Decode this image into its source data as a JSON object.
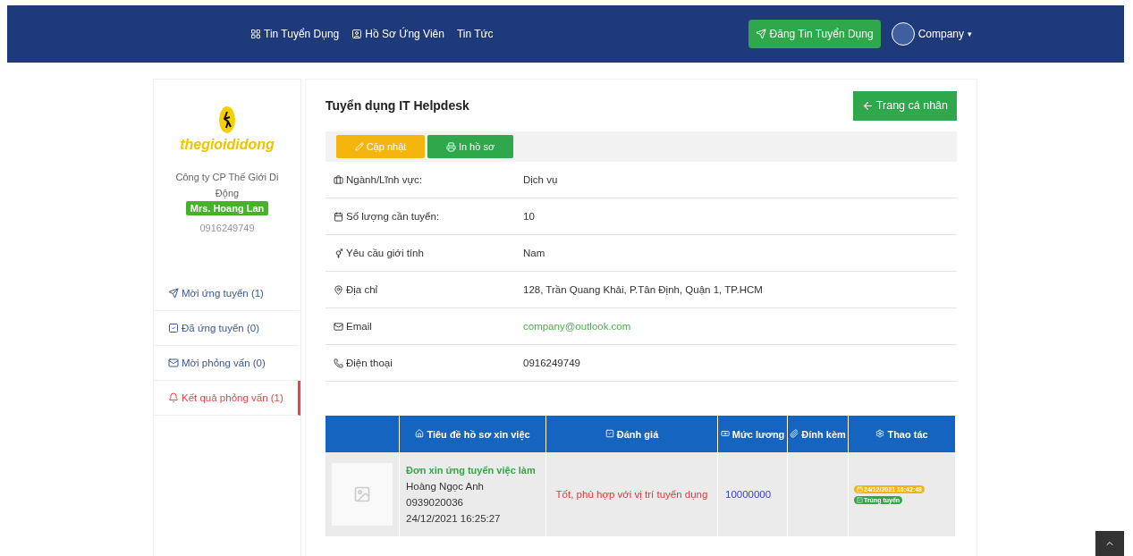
{
  "navbar": {
    "links": [
      {
        "label": "Tin Tuyển Dụng"
      },
      {
        "label": "Hồ Sơ Ứng Viên"
      },
      {
        "label": "Tin Tức"
      }
    ],
    "post_button": "Đăng Tin Tuyển Dụng",
    "account": "Company",
    "account_caret": "▾"
  },
  "sidebar": {
    "logo_text": "thegioididong",
    "company": "Công ty CP Thế Giới Di Động",
    "contact": "Mrs. Hoang Lan",
    "phone": "0916249749",
    "items": [
      {
        "label": "Mời ứng tuyển (1)",
        "selected": false
      },
      {
        "label": "Đã ứng tuyển (0)",
        "selected": false
      },
      {
        "label": "Mời phỏng vấn (0)",
        "selected": false
      },
      {
        "label": "Kết quả phỏng vấn (1)",
        "selected": true
      }
    ]
  },
  "job": {
    "title": "Tuyển dụng IT Helpdesk",
    "back_button": "Trang cá nhân",
    "update_button": "Cập nhật",
    "print_button": "In hồ sơ",
    "fields": [
      {
        "label": "Ngành/Lĩnh vực:",
        "value": "Dịch vụ",
        "kind": "text"
      },
      {
        "label": "Số lượng cần tuyển:",
        "value": "10",
        "kind": "text"
      },
      {
        "label": "Yêu cầu giới tính",
        "value": "Nam",
        "kind": "text"
      },
      {
        "label": "Địa chỉ",
        "value": "128, Trần Quang Khải, P.Tân Định, Quận 1, TP.HCM",
        "kind": "text"
      },
      {
        "label": "Email",
        "value": "company@outlook.com",
        "kind": "link"
      },
      {
        "label": "Điện thoại",
        "value": "0916249749",
        "kind": "text"
      }
    ]
  },
  "table": {
    "columns": [
      "Tiêu đề hồ sơ xin việc",
      "Đánh giá",
      "Mức lương",
      "Đính kèm",
      "Thao tác"
    ],
    "rows": [
      {
        "title": "Đơn xin ứng tuyển việc làm",
        "name": "Hoàng Ngọc Anh",
        "phone": "0939020036",
        "date": "24/12/2021 16:25:27",
        "review": "Tốt, phù hợp với vị trí tuyển dụng",
        "salary": "10000000",
        "action_date": "24/12/2021 16:42:48",
        "status": "Trúng tuyển"
      }
    ]
  }
}
